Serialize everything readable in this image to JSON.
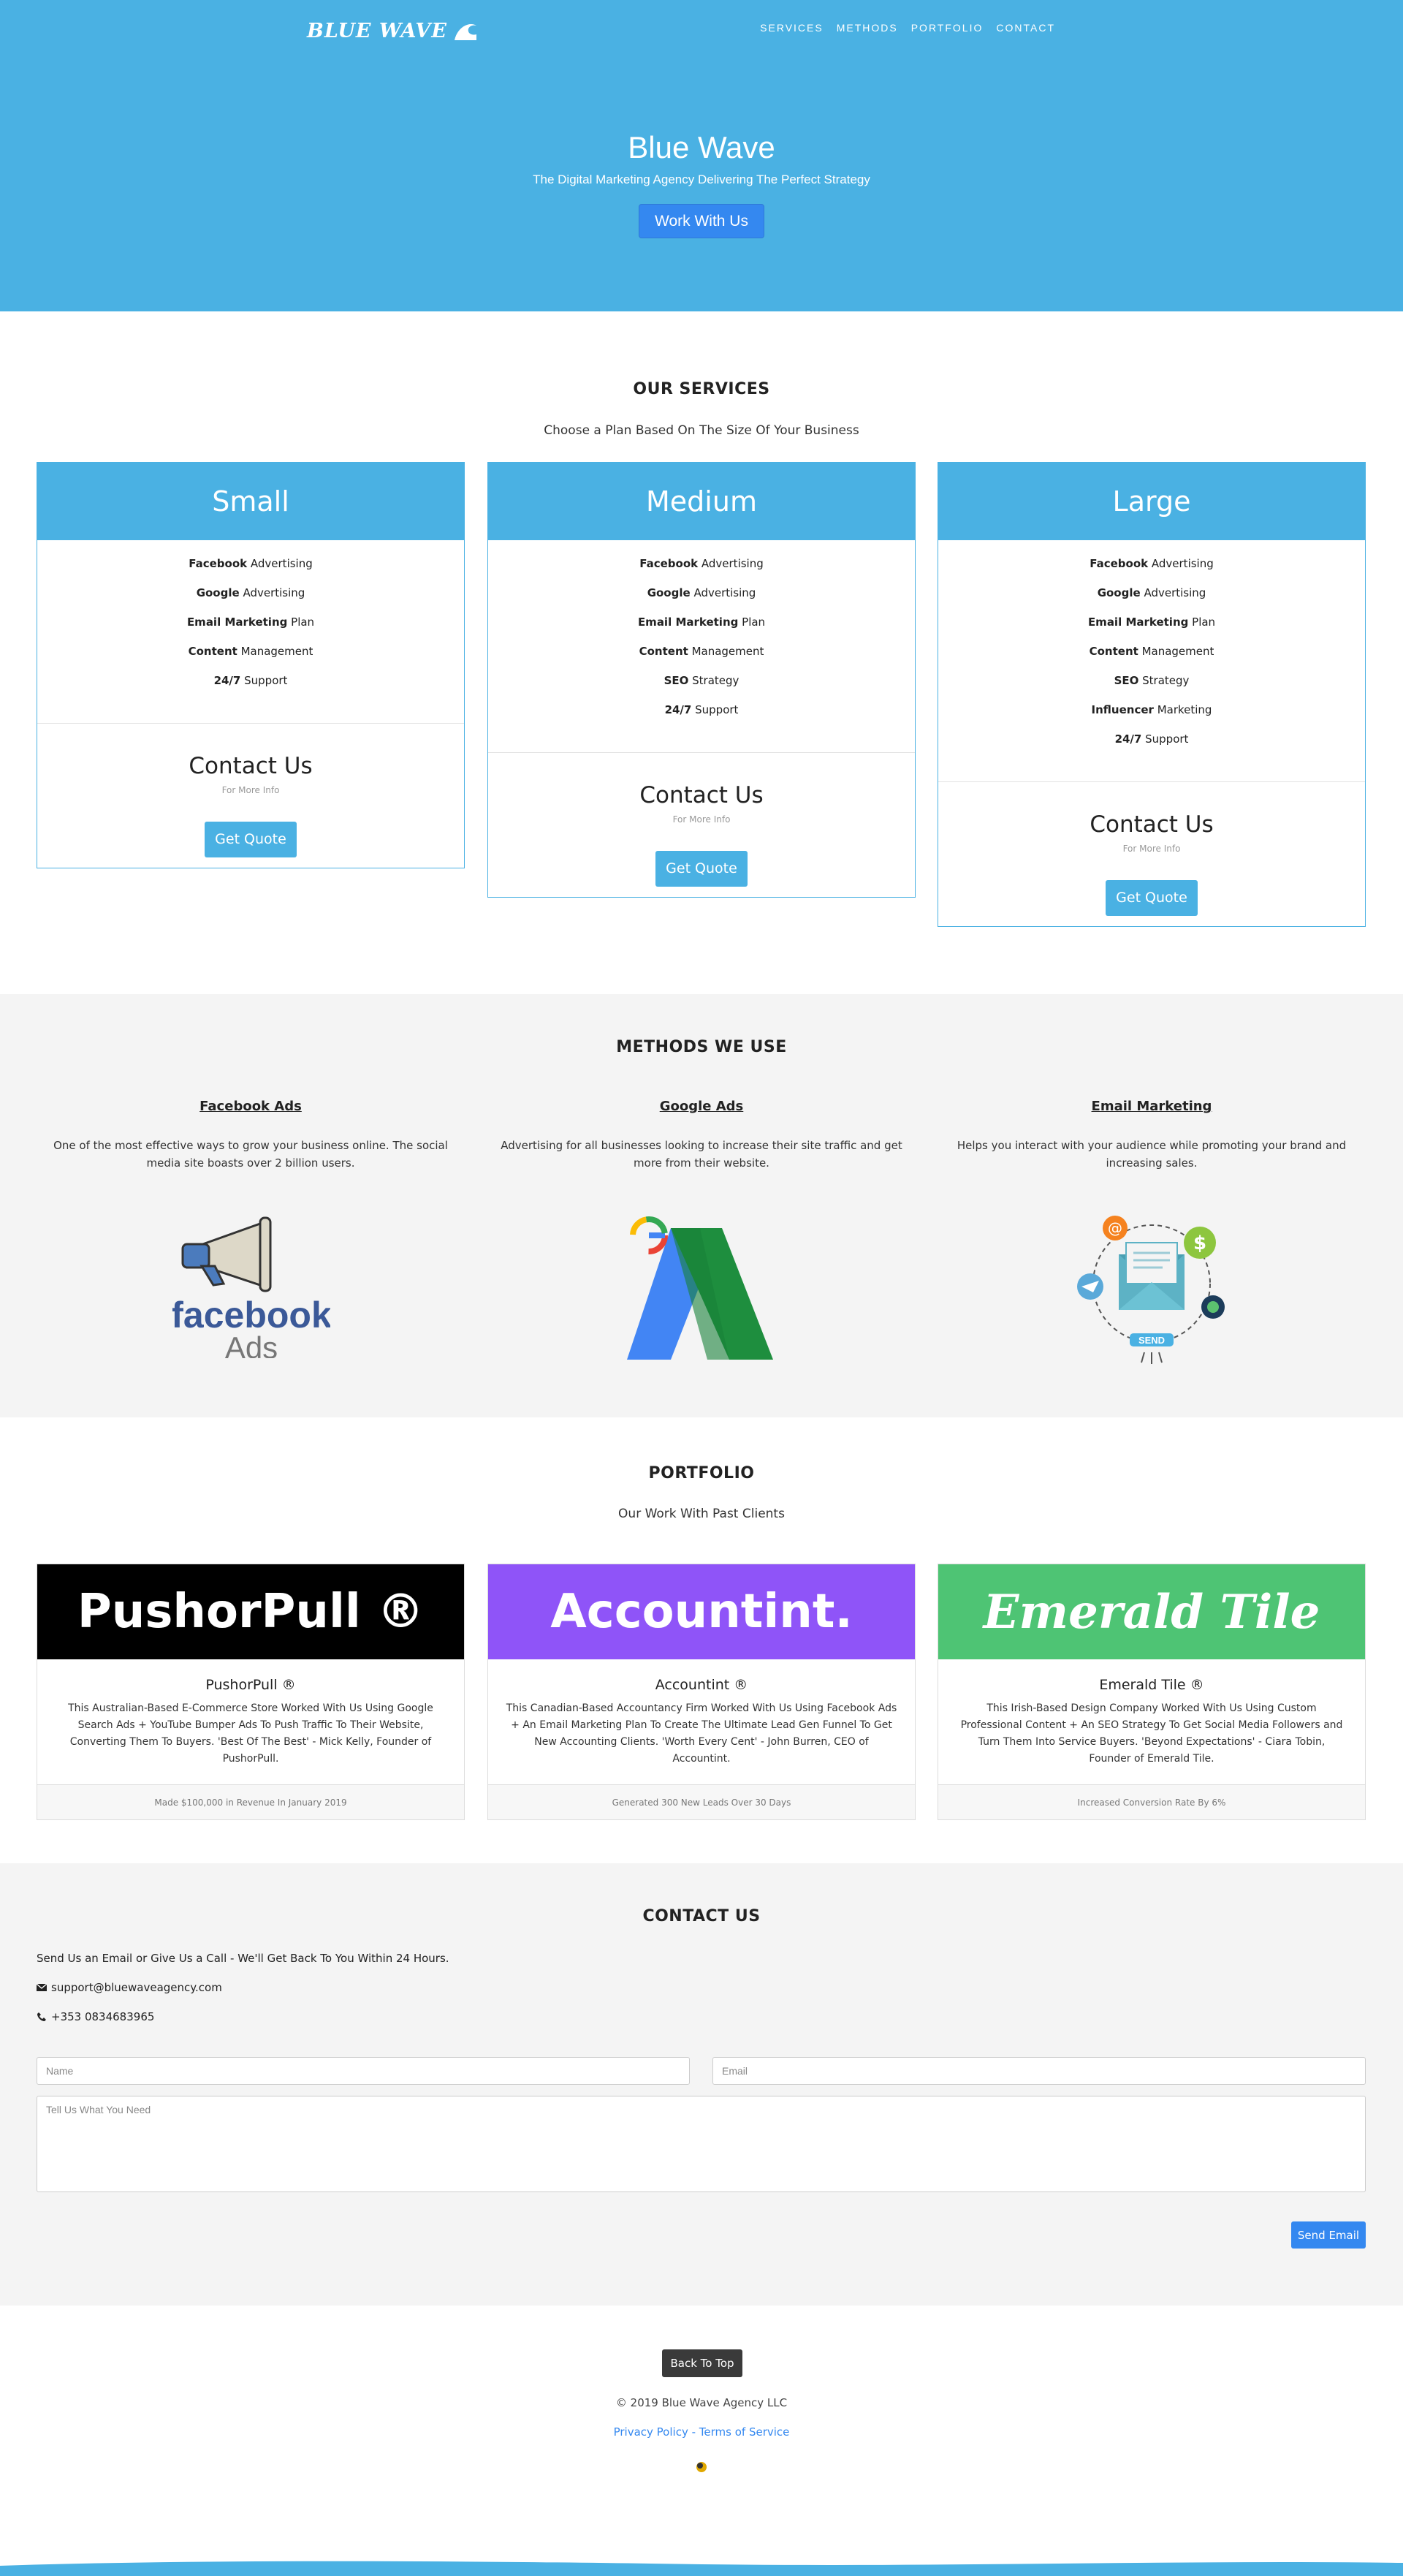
{
  "brand": {
    "name": "BLUE WAVE"
  },
  "nav": [
    "SERVICES",
    "METHODS",
    "PORTFOLIO",
    "CONTACT"
  ],
  "hero": {
    "title": "Blue Wave",
    "subtitle": "The Digital Marketing Agency Delivering The Perfect Strategy",
    "cta": "Work With Us"
  },
  "services": {
    "title": "OUR SERVICES",
    "subtitle": "Choose a Plan Based On The Size Of Your Business",
    "plans": [
      {
        "name": "Small",
        "features": [
          {
            "bold": "Facebook",
            "rest": " Advertising"
          },
          {
            "bold": "Google",
            "rest": " Advertising"
          },
          {
            "bold": "Email Marketing",
            "rest": " Plan"
          },
          {
            "bold": "Content",
            "rest": " Management"
          },
          {
            "bold": "24/7",
            "rest": " Support"
          }
        ],
        "contact": "Contact Us",
        "note": "For More Info",
        "button": "Get Quote"
      },
      {
        "name": "Medium",
        "features": [
          {
            "bold": "Facebook",
            "rest": " Advertising"
          },
          {
            "bold": "Google",
            "rest": " Advertising"
          },
          {
            "bold": "Email Marketing",
            "rest": " Plan"
          },
          {
            "bold": "Content",
            "rest": " Management"
          },
          {
            "bold": "SEO",
            "rest": " Strategy"
          },
          {
            "bold": "24/7",
            "rest": " Support"
          }
        ],
        "contact": "Contact Us",
        "note": "For More Info",
        "button": "Get Quote"
      },
      {
        "name": "Large",
        "features": [
          {
            "bold": "Facebook",
            "rest": " Advertising"
          },
          {
            "bold": "Google",
            "rest": " Advertising"
          },
          {
            "bold": "Email Marketing",
            "rest": " Plan"
          },
          {
            "bold": "Content",
            "rest": " Management"
          },
          {
            "bold": "SEO",
            "rest": " Strategy"
          },
          {
            "bold": "Influencer",
            "rest": " Marketing"
          },
          {
            "bold": "24/7",
            "rest": " Support"
          }
        ],
        "contact": "Contact Us",
        "note": "For More Info",
        "button": "Get Quote"
      }
    ]
  },
  "methods": {
    "title": "METHODS WE USE",
    "items": [
      {
        "heading": "Facebook Ads",
        "text": "One of the most effective ways to grow your business online. The social media site boasts over 2 billion users.",
        "logo_word": "facebook",
        "logo_sub": "Ads",
        "icon": "megaphone-icon"
      },
      {
        "heading": "Google Ads",
        "text": "Advertising for all businesses looking to increase their site traffic and get more from their website.",
        "icon": "google-ads-icon"
      },
      {
        "heading": "Email Marketing",
        "text": "Helps you interact with your audience while promoting your brand and increasing sales.",
        "send_label": "SEND",
        "icon": "email-envelope-icon"
      }
    ]
  },
  "portfolio": {
    "title": "PORTFOLIO",
    "subtitle": "Our Work With Past Clients",
    "items": [
      {
        "banner": "PushorPull ®",
        "name": "PushorPull ®",
        "color": "#000000",
        "desc": "This Australian-Based E-Commerce Store Worked With Us Using Google Search Ads + YouTube Bumper Ads To Push Traffic To Their Website, Converting Them To Buyers. 'Best Of The Best' - Mick Kelly, Founder of PushorPull.",
        "result": "Made $100,000 in Revenue In January 2019"
      },
      {
        "banner": "Accountint.",
        "name": "Accountint ®",
        "color": "#8f54f8",
        "desc": "This Canadian-Based Accountancy Firm Worked With Us Using Facebook Ads + An Email Marketing Plan To Create The Ultimate Lead Gen Funnel To Get New Accounting Clients. 'Worth Every Cent' - John Burren, CEO of Accountint.",
        "result": "Generated 300 New Leads Over 30 Days"
      },
      {
        "banner": "Emerald Tile",
        "name": "Emerald Tile ®",
        "color": "#4ec474",
        "desc": "This Irish-Based Design Company Worked With Us Using Custom Professional Content + An SEO Strategy To Get Social Media Followers and Turn Them Into Service Buyers. 'Beyond Expectations' - Ciara Tobin, Founder of Emerald Tile.",
        "result": "Increased Conversion Rate By 6%"
      }
    ]
  },
  "contact": {
    "title": "CONTACT US",
    "intro": "Send Us an Email or Give Us a Call - We'll Get Back To You Within 24 Hours.",
    "email": "support@bluewaveagency.com",
    "phone": "+353 0834683965",
    "name_placeholder": "Name",
    "email_placeholder": "Email",
    "message_placeholder": "Tell Us What You Need",
    "send": "Send Email"
  },
  "footer": {
    "back_to_top": "Back To Top",
    "copyright": "© 2019 Blue Wave Agency LLC",
    "privacy": "Privacy Policy",
    "separator": " - ",
    "terms": "Terms of Service"
  },
  "colors": {
    "primary": "#4ab1e3",
    "button_blue": "#3488f0",
    "section_gray": "#f4f4f4"
  }
}
